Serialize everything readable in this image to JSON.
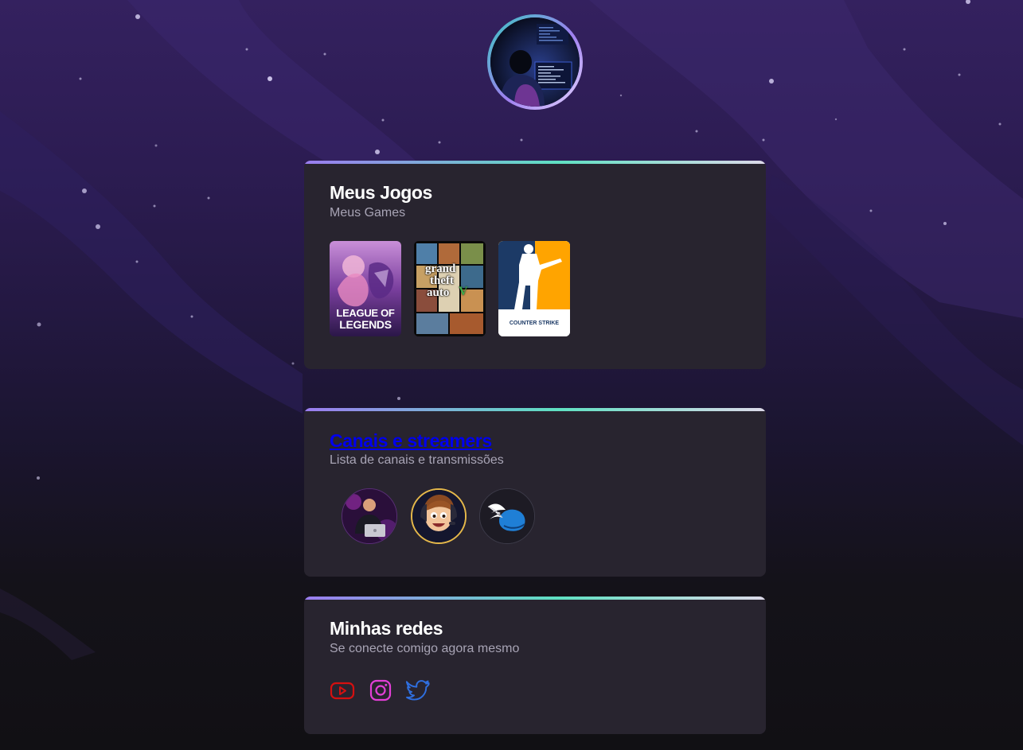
{
  "profile": {
    "avatar_icon": "programmer-avatar-image"
  },
  "games_section": {
    "title": "Meus Jogos",
    "subtitle": "Meus Games",
    "games": [
      {
        "name": "League of Legends",
        "logo_line1": "LEAGUE OF",
        "logo_line2": "LEGENDS"
      },
      {
        "name": "Grand Theft Auto V",
        "logo_line1": "grand",
        "logo_line2": "theft",
        "logo_line3": "auto",
        "logo_mark": "V"
      },
      {
        "name": "Counter-Strike",
        "logo_text": "COUNTER STRIKE"
      }
    ]
  },
  "streams_section": {
    "title": "Canais e streamers",
    "subtitle": "Lista de canais e transmissões",
    "streamers": [
      {
        "icon": "streamer-laptop-avatar"
      },
      {
        "icon": "streamer-cartoon-avatar"
      },
      {
        "icon": "winged-helmet-avatar"
      }
    ]
  },
  "social_section": {
    "title": "Minhas redes",
    "subtitle": "Se conecte comigo agora mesmo",
    "links": [
      {
        "network": "YouTube",
        "icon": "youtube-icon",
        "color": "#d51010"
      },
      {
        "network": "Instagram",
        "icon": "instagram-icon",
        "color": "#e33fd7"
      },
      {
        "network": "Twitter",
        "icon": "twitter-icon",
        "color": "#2f6fe0"
      }
    ]
  },
  "colors": {
    "card_background": "#28242f",
    "accent_gradient": [
      "#9b7cf0",
      "#5fe0c2",
      "#ddd9e9"
    ],
    "page_background_top": "#34215f",
    "page_background_bottom": "#111014"
  }
}
